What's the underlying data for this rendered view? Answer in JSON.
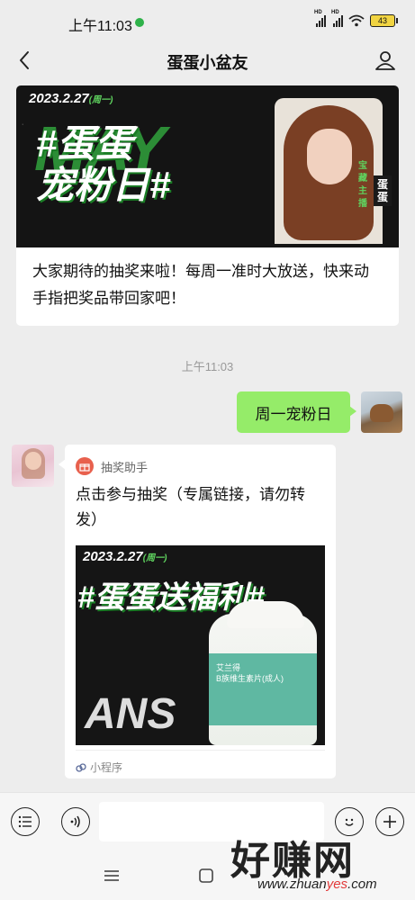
{
  "status_bar": {
    "time": "上午11:03",
    "battery": "43",
    "icons": [
      "wechat-dot-icon",
      "signal-hd-icon",
      "signal-hd-icon",
      "wifi-icon",
      "battery-icon"
    ]
  },
  "nav": {
    "title": "蛋蛋小盆友",
    "back_icon": "chevron-left-icon",
    "profile_icon": "person-icon"
  },
  "article": {
    "banner_date": "2023.2.27",
    "banner_date_sub": "(周一)",
    "banner_headline_1": "#蛋蛋",
    "banner_headline_2": "宠粉日#",
    "banner_bg_text": "MAY",
    "banner_tag": "蛋蛋",
    "banner_tag_green": "宝藏主播",
    "text": "大家期待的抽奖来啦！每周一准时大放送，快来动手指把奖品带回家吧！"
  },
  "chat": {
    "timestamp": "上午11:03",
    "outgoing_message": "周一宠粉日",
    "mini_program": {
      "source": "抽奖助手",
      "title": "点击参与抽奖（专属链接，请勿转发）",
      "image_date": "2023.2.27",
      "image_date_sub": "(周一)",
      "image_headline": "#蛋蛋送福利#",
      "bottle_text_1": "艾兰得",
      "bottle_text_2": "B族维生素片(成人)",
      "image_bg_text": "ANS",
      "footer_label": "小程序"
    }
  },
  "input_bar": {
    "voice_icon": "voice-icon",
    "menu_icon": "list-icon",
    "emoji_icon": "emoji-icon",
    "add_icon": "plus-icon"
  },
  "watermark": {
    "big": "好赚网",
    "small_a": "www.zhuan",
    "small_b": "yes",
    "small_c": ".com"
  }
}
